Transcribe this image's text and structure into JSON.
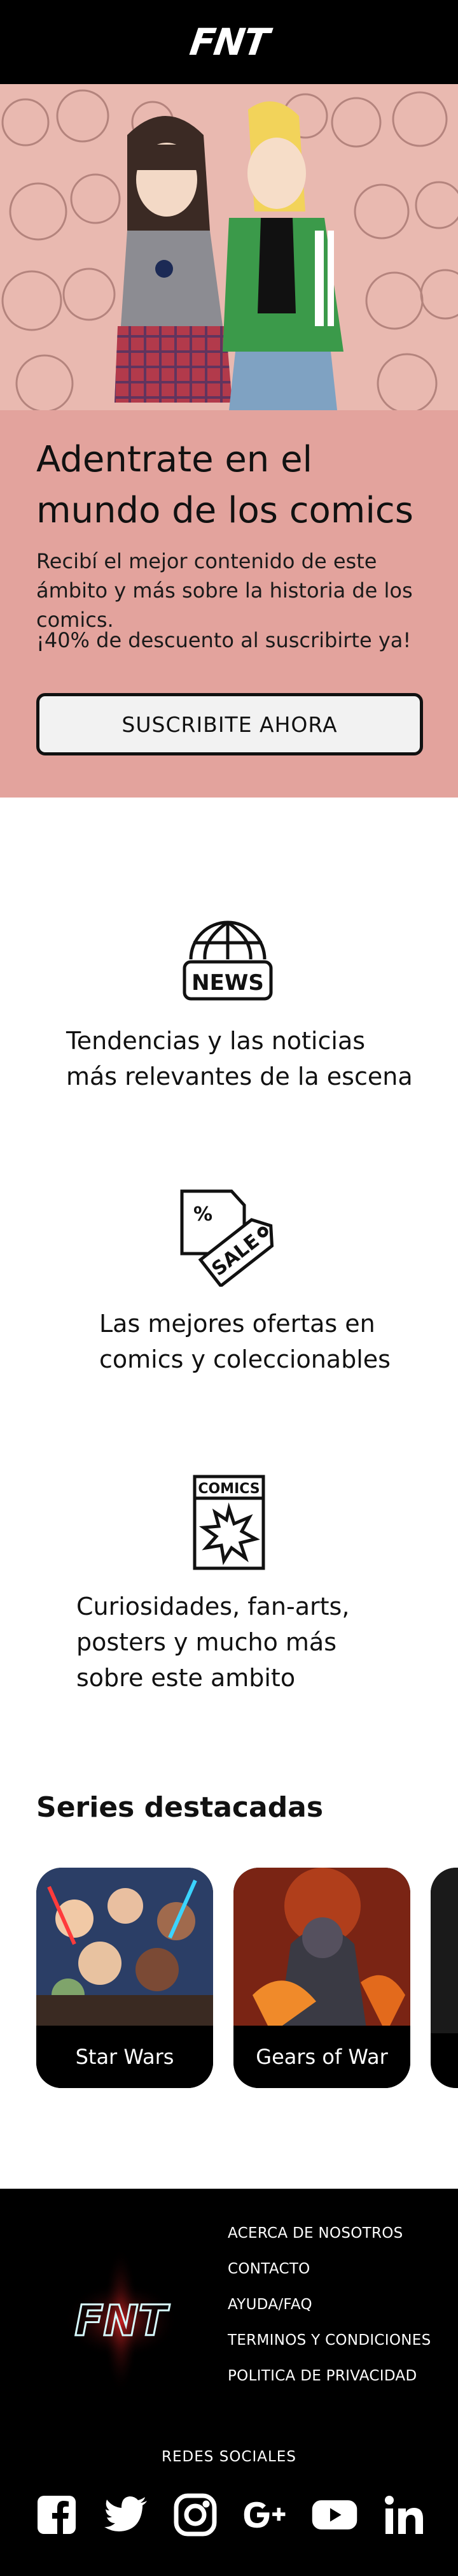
{
  "header": {
    "logo_text": "FNT"
  },
  "promo": {
    "title": "Adentrate en el mundo de los comics",
    "text": "Recibí el mejor contenido de este ámbito y más sobre la historia de los comics.",
    "discount": "¡40% de descuento al suscribirte ya!",
    "cta_label": "SUSCRIBITE AHORA"
  },
  "features": [
    {
      "icon": "news-globe-icon",
      "icon_text": "NEWS",
      "text": "Tendencias y las noticias más relevantes de la escena"
    },
    {
      "icon": "sale-tag-icon",
      "icon_text": "SALE",
      "text": "Las mejores ofertas en comics y coleccionables"
    },
    {
      "icon": "comics-book-icon",
      "icon_text": "COMICS",
      "text": "Curiosidades, fan-arts, posters y mucho más sobre este ambito"
    }
  ],
  "series": {
    "heading": "Series destacadas",
    "items": [
      {
        "label": "Star Wars"
      },
      {
        "label": "Gears of War"
      }
    ]
  },
  "footer": {
    "logo_text": "FNT",
    "links": [
      "ACERCA DE NOSOTROS",
      "CONTACTO",
      "AYUDA/FAQ",
      "TERMINOS Y CONDICIONES",
      "POLITICA DE PRIVACIDAD"
    ],
    "social_heading": "REDES SOCIALES",
    "social_icons": [
      "facebook-icon",
      "twitter-icon",
      "instagram-icon",
      "google-plus-icon",
      "youtube-icon",
      "linkedin-icon"
    ]
  },
  "colors": {
    "promo_bg": "#e3a39d",
    "topbar_bg": "#000000",
    "footer_bg": "#000000",
    "neon": "#00e5ff"
  }
}
